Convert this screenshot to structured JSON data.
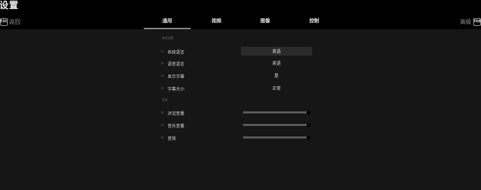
{
  "header": {
    "title": "设置",
    "back_key": "ESC",
    "back_label": "返回",
    "advanced_label": "高级",
    "advanced_key": "TAB"
  },
  "tabs": [
    {
      "label": "通用",
      "active": true
    },
    {
      "label": "视频",
      "active": false
    },
    {
      "label": "图像",
      "active": false
    },
    {
      "label": "控制",
      "active": false
    }
  ],
  "language_section": {
    "heading": "语言设置",
    "rows": [
      {
        "label": "系统语言",
        "value": "英语",
        "selected": true
      },
      {
        "label": "语音语言",
        "value": "英语",
        "selected": false
      },
      {
        "label": "显示字幕",
        "value": "是",
        "selected": false
      },
      {
        "label": "字幕大小",
        "value": "正常",
        "selected": false
      }
    ]
  },
  "audio_section": {
    "heading": "音频",
    "sliders": [
      {
        "label": "对话音量",
        "level": 1.0
      },
      {
        "label": "音乐音量",
        "level": 1.0
      },
      {
        "label": "音效",
        "level": 1.0
      }
    ]
  },
  "colors": {
    "background": "#161616",
    "topbar": "#000000",
    "selected_value_bg": "#2b2b2b",
    "slider_track": "#444444",
    "slider_knob": "#050505"
  },
  "icons": {
    "row_marker": "double-chevron-right-icon"
  }
}
